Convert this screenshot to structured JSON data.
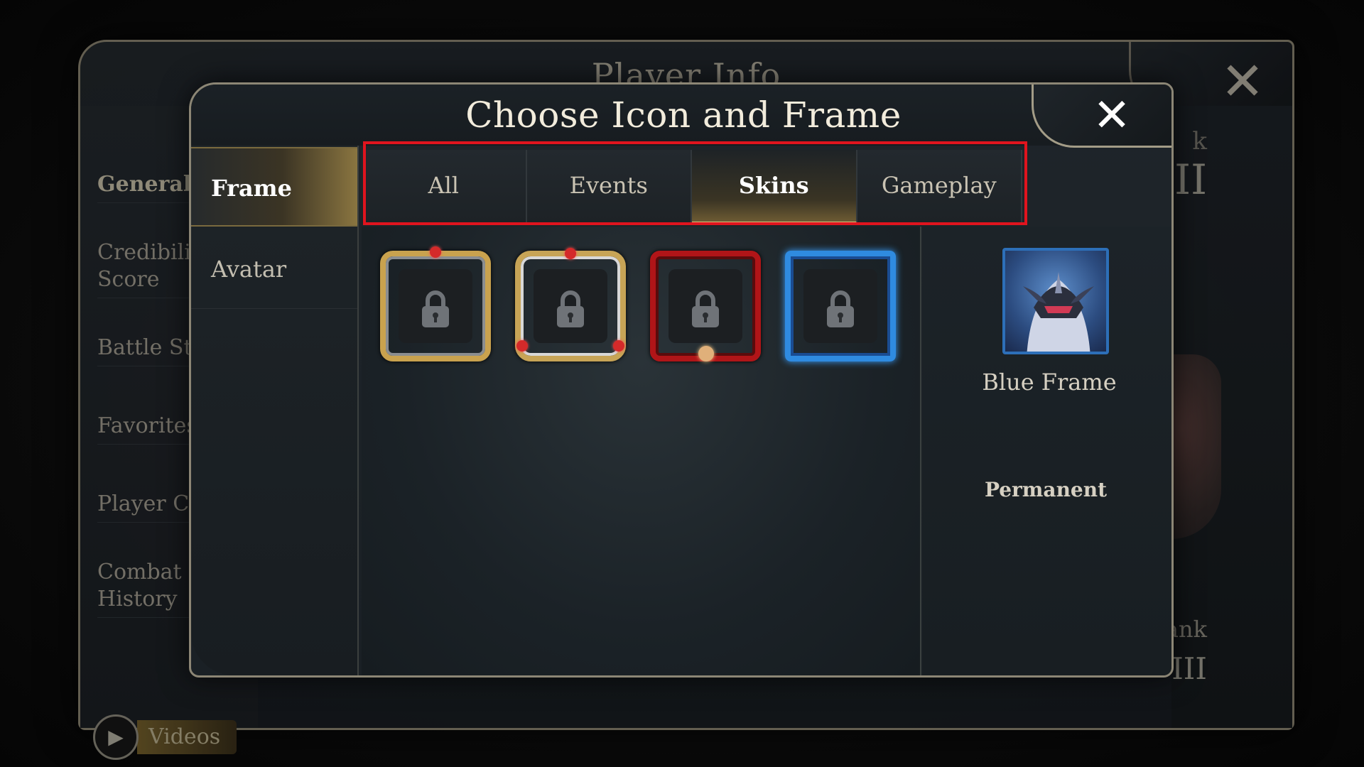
{
  "background_panel": {
    "title": "Player Info",
    "close_icon": "close-icon",
    "sidebar": {
      "items": [
        {
          "label": "General"
        },
        {
          "label": "Credibili­ty Score"
        },
        {
          "label": "Battle St"
        },
        {
          "label": "Favorites"
        },
        {
          "label": "Player Ca"
        },
        {
          "label": "Combat History"
        }
      ]
    },
    "videos_label": "Videos",
    "rank_label_top": "k",
    "rank_tier_top": "II",
    "rank_label_bottom": "ank",
    "rank_tier_bottom": "III"
  },
  "dialog": {
    "title": "Choose Icon and Frame",
    "close_icon": "close-icon",
    "categories": [
      {
        "label": "Frame",
        "active": true
      },
      {
        "label": "Avatar",
        "active": false
      }
    ],
    "tabs": [
      {
        "label": "All",
        "active": false
      },
      {
        "label": "Events",
        "active": false
      },
      {
        "label": "Skins",
        "active": true
      },
      {
        "label": "Gameplay",
        "active": false
      }
    ],
    "frames": [
      {
        "style": "gold-silver",
        "locked": true
      },
      {
        "style": "gold-heart",
        "locked": true
      },
      {
        "style": "red",
        "locked": true
      },
      {
        "style": "blue",
        "locked": true
      }
    ],
    "preview": {
      "name": "Blue Frame",
      "duration": "Permanent"
    }
  },
  "colors": {
    "highlight_box": "#e0141e",
    "accent_gold": "#d8c07a",
    "blue_frame": "#2f8be0"
  }
}
